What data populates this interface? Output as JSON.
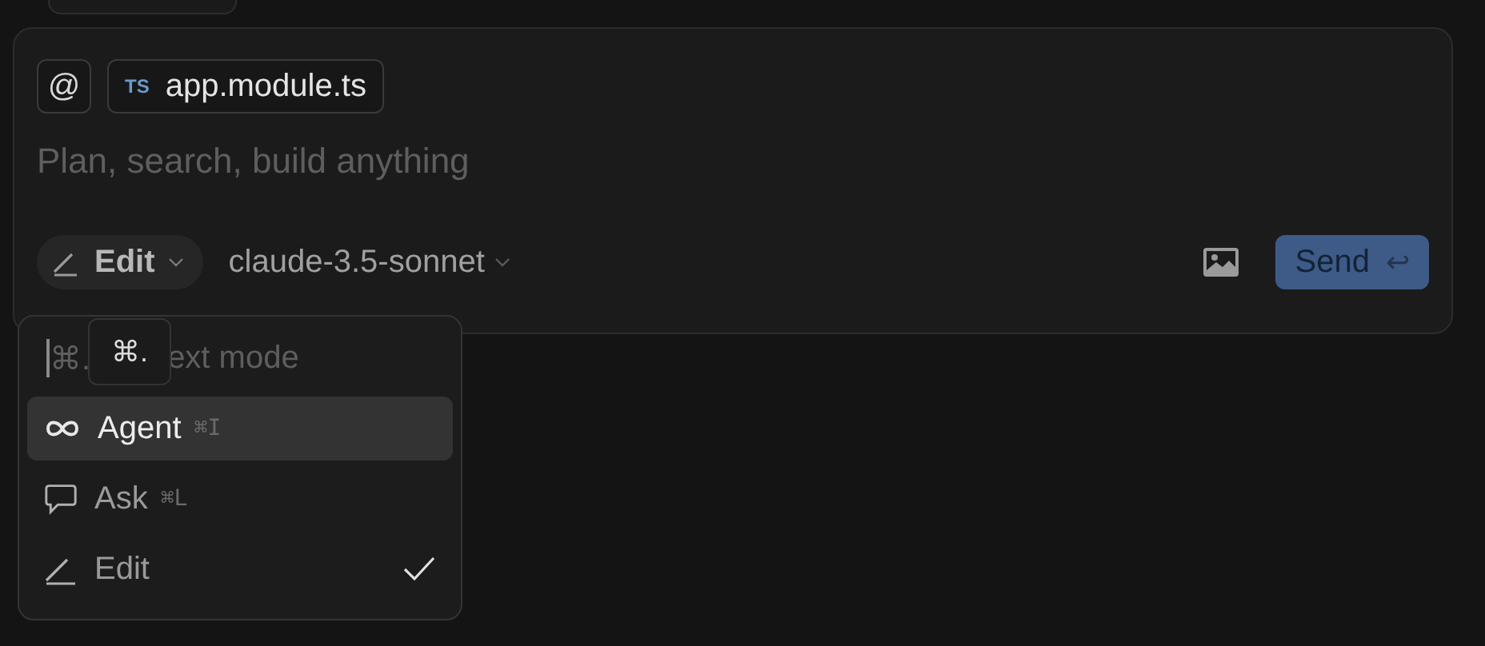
{
  "composer": {
    "mention_symbol": "@",
    "context_chip": {
      "badge": "TS",
      "label": "app.module.ts"
    },
    "placeholder": "Plan, search, build anything",
    "mode_button": {
      "label": "Edit"
    },
    "model": "claude-3.5-sonnet",
    "send_button": {
      "label": "Send",
      "symbol": "↩"
    }
  },
  "mode_menu": {
    "search": {
      "caret_text": "⌘.",
      "hint_end": "ext mode"
    },
    "tooltip": "⌘.",
    "items": [
      {
        "kind": "agent",
        "label": "Agent",
        "shortcut": "⌘I",
        "selected": true,
        "checked": false
      },
      {
        "kind": "ask",
        "label": "Ask",
        "shortcut": "⌘L",
        "selected": false,
        "checked": false
      },
      {
        "kind": "edit",
        "label": "Edit",
        "selected": false,
        "checked": true
      }
    ]
  }
}
